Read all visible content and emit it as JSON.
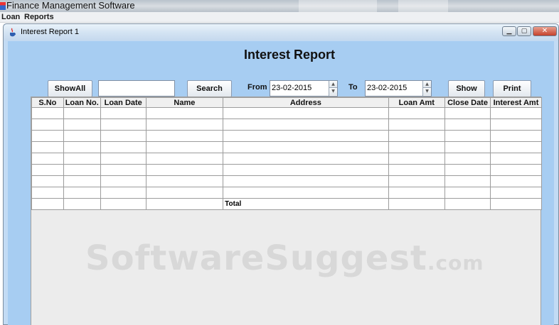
{
  "app": {
    "title": "Finance Management Software"
  },
  "menu": [
    {
      "label": "Loan"
    },
    {
      "label": "Reports"
    }
  ],
  "window": {
    "title": "Interest Report 1",
    "controls": [
      "minimize",
      "maximize",
      "close"
    ]
  },
  "report": {
    "heading": "Interest Report",
    "show_all_label": "ShowAll",
    "search_value": "",
    "search_label": "Search",
    "from_label": "From",
    "from_date": "23-02-2015",
    "to_label": "To",
    "to_date": "23-02-2015",
    "show_label": "Show",
    "print_label": "Print"
  },
  "table": {
    "columns": [
      "S.No",
      "Loan No.",
      "Loan Date",
      "Name",
      "Address",
      "Loan Amt",
      "Close Date",
      "Interest Amt"
    ],
    "empty_rows": 8,
    "total_label": "Total"
  },
  "watermark": {
    "text": "SoftwareSuggest",
    "suffix": ".com"
  },
  "colors": {
    "panel_bg": "#a7cdf2",
    "frame_bg": "#c2dbf4",
    "table_bg": "#ffffff",
    "empty_area": "#ececec"
  },
  "icons": {
    "app": "java-cup-icon",
    "window": "java-cup-icon"
  }
}
